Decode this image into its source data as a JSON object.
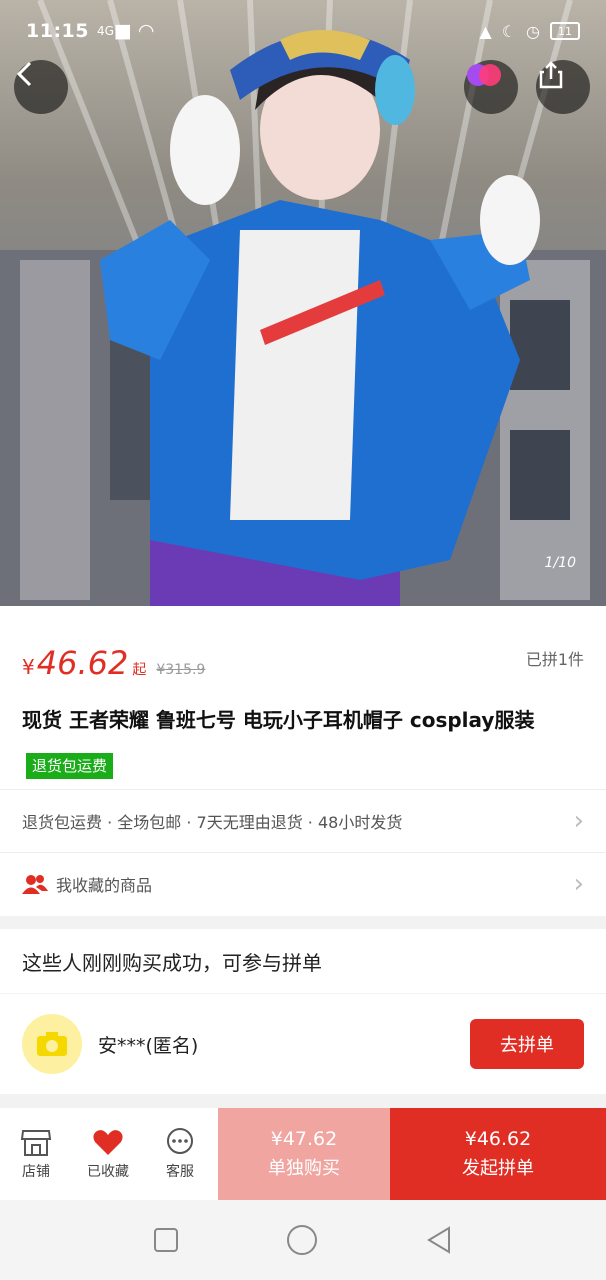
{
  "status_bar": {
    "time": "11:15",
    "network": "4G",
    "battery": "11"
  },
  "gallery": {
    "counter": "1/10"
  },
  "price": {
    "currency": "¥",
    "amount": "46.62",
    "suffix": "起",
    "original": "¥315.9",
    "sold": "已拼1件"
  },
  "product": {
    "title": "现货 王者荣耀 鲁班七号 电玩小子耳机帽子 cosplay服装",
    "tag": "退货包运费"
  },
  "service_row": {
    "text": "退货包运费 · 全场包邮 · 7天无理由退货 · 48小时发货"
  },
  "favorites_row": {
    "text": "我收藏的商品"
  },
  "group_buy": {
    "heading": "这些人刚刚购买成功，可参与拼单",
    "user": "安***(匿名)",
    "join_label": "去拼单"
  },
  "bottom_bar": {
    "store_label": "店铺",
    "favorite_label": "已收藏",
    "service_label": "客服",
    "alone_price": "¥47.62",
    "alone_label": "单独购买",
    "group_price": "¥46.62",
    "group_label": "发起拼单"
  },
  "colors": {
    "accent": "#e02e24",
    "tag_green": "#1aad19",
    "alone_bg": "#f0a5a1"
  },
  "icons": [
    "chevron-left-icon",
    "share-icon",
    "brand-logo-icon",
    "people-icon",
    "camera-icon",
    "store-icon",
    "heart-icon",
    "chat-icon",
    "square-icon",
    "circle-icon",
    "triangle-back-icon"
  ]
}
